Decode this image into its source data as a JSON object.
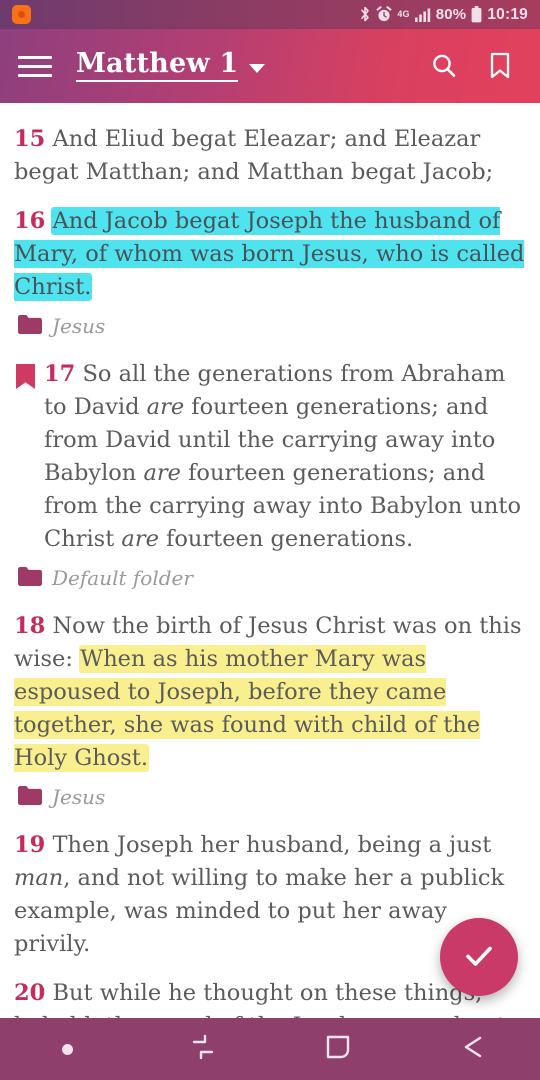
{
  "statusbar": {
    "notification_icon": "app-notification-icon",
    "bluetooth_icon": "bluetooth-icon",
    "alarm_icon": "alarm-icon",
    "network_label": "4G",
    "signal_icon": "signal-bars-icon",
    "battery_percent": "80%",
    "battery_icon": "battery-icon",
    "time": "10:19"
  },
  "appbar": {
    "menu_icon": "hamburger-menu-icon",
    "title": "Matthew 1",
    "caret_icon": "chevron-down-icon",
    "search_icon": "search-icon",
    "bookmark_icon": "bookmark-icon"
  },
  "verses": [
    {
      "number": "15",
      "flag": false,
      "segments": [
        {
          "text": "And Eliud begat Eleazar; and Eleazar begat Matthan; and Matthan begat Jacob;",
          "style": "plain"
        }
      ],
      "tag": null
    },
    {
      "number": "16",
      "flag": false,
      "segments": [
        {
          "text": "And Jacob begat Joseph the husband of Mary, of whom was born Jesus, who is called Christ.",
          "style": "cyan"
        }
      ],
      "tag": "Jesus"
    },
    {
      "number": "17",
      "flag": true,
      "segments": [
        {
          "text": "So all the generations from Abraham to David ",
          "style": "plain"
        },
        {
          "text": "are",
          "style": "italic"
        },
        {
          "text": " fourteen generations; and from David until the carrying away into Babylon ",
          "style": "plain"
        },
        {
          "text": "are",
          "style": "italic"
        },
        {
          "text": " fourteen generations; and from the carrying away into Babylon unto Christ ",
          "style": "plain"
        },
        {
          "text": "are",
          "style": "italic"
        },
        {
          "text": " fourteen generations.",
          "style": "plain"
        }
      ],
      "tag": "Default folder"
    },
    {
      "number": "18",
      "flag": false,
      "segments": [
        {
          "text": "Now the birth of Jesus Christ was on this wise: ",
          "style": "plain"
        },
        {
          "text": "When as his mother Mary was espoused to Joseph, before they came together, she was found with child of the Holy Ghost.",
          "style": "yellow"
        }
      ],
      "tag": "Jesus"
    },
    {
      "number": "19",
      "flag": false,
      "segments": [
        {
          "text": "Then Joseph her husband, being a just ",
          "style": "plain"
        },
        {
          "text": "man",
          "style": "italic"
        },
        {
          "text": ", and not willing to make her a publick example, was minded to put her away privily.",
          "style": "plain"
        }
      ],
      "tag": null
    },
    {
      "number": "20",
      "flag": false,
      "segments": [
        {
          "text": "But while he thought on these things, behold, the angel of the Lord appeared unto",
          "style": "plain"
        }
      ],
      "tag": null
    }
  ],
  "fab": {
    "icon": "check-icon"
  },
  "navbar": {
    "items": [
      {
        "icon": "dot-indicator-icon",
        "name": "nav-dot"
      },
      {
        "icon": "recents-icon",
        "name": "nav-recents-button"
      },
      {
        "icon": "home-square-icon",
        "name": "nav-home-button"
      },
      {
        "icon": "back-arrow-icon",
        "name": "nav-back-button"
      }
    ]
  },
  "colors": {
    "appbar_start": "#8e3f7e",
    "appbar_end": "#e2415c",
    "verse_number": "#c62b5a",
    "verse_text": "#5b5b5b",
    "highlight_cyan": "#4fe3ef",
    "highlight_yellow": "#f9ef8e",
    "folder_icon": "#9e3a66",
    "flag_icon": "#cf3a63",
    "fab": "#c93a68",
    "navbar": "#8e3f6b"
  }
}
